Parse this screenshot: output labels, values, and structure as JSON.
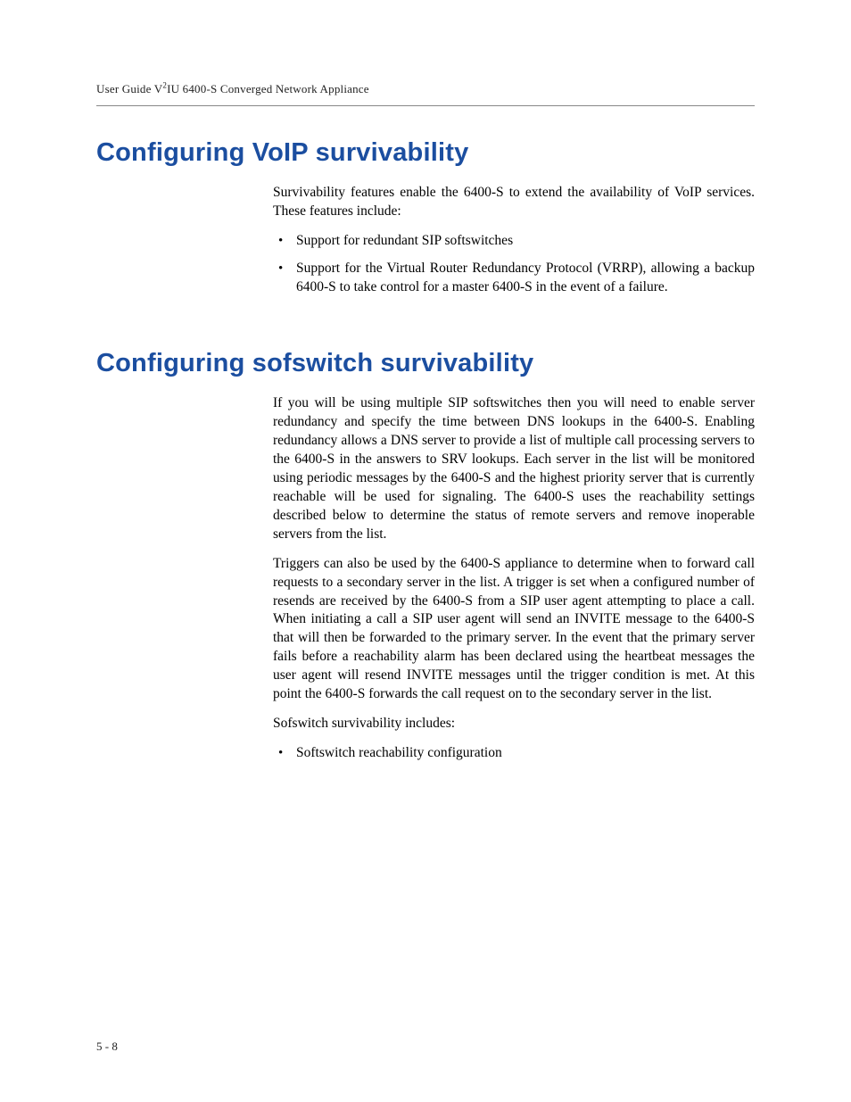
{
  "header": {
    "prefix": "User Guide V",
    "sup": "2",
    "suffix": "IU 6400-S Converged Network Appliance"
  },
  "sections": [
    {
      "title": "Configuring VoIP survivability",
      "paragraphs": [
        "Survivability features enable the 6400-S to extend the availability of VoIP services. These features include:"
      ],
      "bullets": [
        "Support for redundant SIP softswitches",
        "Support for the Virtual Router Redundancy Protocol (VRRP), allowing a backup 6400-S to take control for a master 6400-S in the event of a failure."
      ]
    },
    {
      "title": "Configuring sofswitch survivability",
      "paragraphs": [
        "If you will be using multiple SIP softswitches then you will need to enable server redundancy and specify the time between DNS lookups in the 6400-S. Enabling redundancy allows a DNS server to provide a list of multiple call processing servers to the 6400-S in the answers to SRV lookups.  Each server in the list will be monitored using periodic messages by the 6400-S and the highest priority server that is currently reachable will be used for signaling. The 6400-S uses the reachability settings described below to determine the status of remote servers and remove inoperable servers from the list.",
        "Triggers can also be used by the 6400-S appliance to determine when to forward call requests to a secondary server in the list. A trigger is set when a configured number of resends are received by the 6400-S from a SIP user agent attempting to place a call.  When initiating a call a SIP user agent will send an INVITE message to the 6400-S that will then be forwarded to the primary server. In the event that the primary server fails before a reachability alarm has been declared using the heartbeat messages the user agent will resend INVITE messages until the trigger condition is met.  At this point the 6400-S forwards the call request on to the secondary server in the list.",
        "Sofswitch survivability includes:"
      ],
      "bullets": [
        "Softswitch reachability configuration"
      ]
    }
  ],
  "pageNumber": "5 - 8"
}
